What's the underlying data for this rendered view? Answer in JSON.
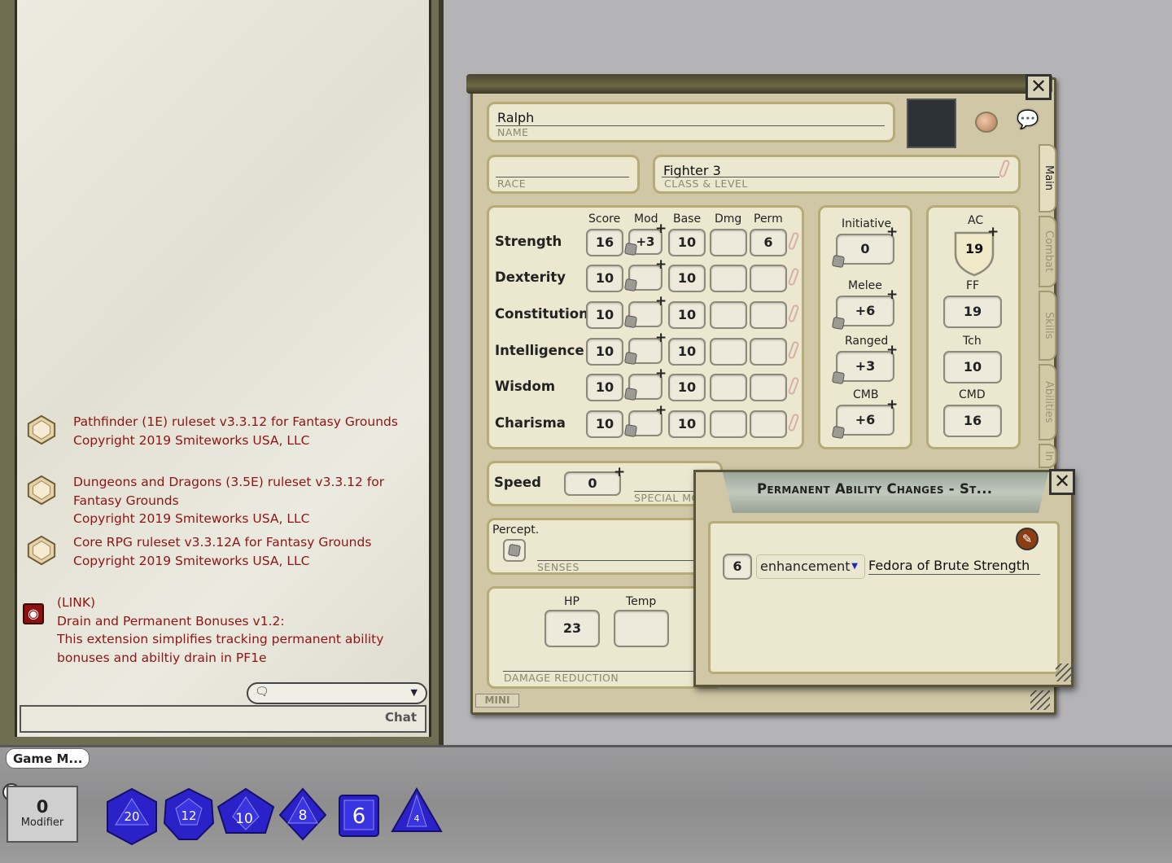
{
  "chat": {
    "messages": [
      {
        "text": "Pathfinder (1E) ruleset v3.3.12 for Fantasy Grounds\nCopyright 2019 Smiteworks USA, LLC",
        "icon": "ruleset-gem-icon"
      },
      {
        "text": "Dungeons and Dragons (3.5E) ruleset v3.3.12 for\nFantasy Grounds\nCopyright 2019 Smiteworks USA, LLC",
        "icon": "ruleset-gem-icon"
      },
      {
        "text": "Core RPG ruleset v3.3.12A for Fantasy Grounds\nCopyright 2019 Smiteworks USA, LLC",
        "icon": "ruleset-gem-icon"
      },
      {
        "text": "(LINK)\nDrain and Permanent Bonuses v1.2:\nThis extension simplifies tracking permanent ability\nbonuses and abiltiy drain in PF1e",
        "icon": "extension-link-icon"
      }
    ],
    "chat_label": "Chat",
    "text_color": "#8f1414"
  },
  "bottom": {
    "gm_tab": "Game M...",
    "modifier_value": "0",
    "modifier_label": "Modifier",
    "dice": [
      "20",
      "12",
      "10",
      "8",
      "6",
      "4"
    ],
    "dice_color": "#2a22c8"
  },
  "sheet": {
    "name_value": "Ralph",
    "name_label": "NAME",
    "race_label": "RACE",
    "class_value": "Fighter 3",
    "class_label": "CLASS & LEVEL",
    "col_headers": {
      "score": "Score",
      "mod": "Mod",
      "base": "Base",
      "dmg": "Dmg",
      "perm": "Perm"
    },
    "abilities": [
      {
        "name": "Strength",
        "score": "16",
        "mod": "+3",
        "base": "10",
        "dmg": "",
        "perm": "6"
      },
      {
        "name": "Dexterity",
        "score": "10",
        "mod": "",
        "base": "10",
        "dmg": "",
        "perm": ""
      },
      {
        "name": "Constitution",
        "score": "10",
        "mod": "",
        "base": "10",
        "dmg": "",
        "perm": ""
      },
      {
        "name": "Intelligence",
        "score": "10",
        "mod": "",
        "base": "10",
        "dmg": "",
        "perm": ""
      },
      {
        "name": "Wisdom",
        "score": "10",
        "mod": "",
        "base": "10",
        "dmg": "",
        "perm": ""
      },
      {
        "name": "Charisma",
        "score": "10",
        "mod": "",
        "base": "10",
        "dmg": "",
        "perm": ""
      }
    ],
    "combat": {
      "initiative_label": "Initiative",
      "initiative": "0",
      "melee_label": "Melee",
      "melee": "+6",
      "ranged_label": "Ranged",
      "ranged": "+3",
      "cmb_label": "CMB",
      "cmb": "+6"
    },
    "defense": {
      "ac_label": "AC",
      "ac": "19",
      "ff_label": "FF",
      "ff": "19",
      "tch_label": "Tch",
      "tch": "10",
      "cmd_label": "CMD",
      "cmd": "16"
    },
    "speed_label": "Speed",
    "speed": "0",
    "special_label": "SPECIAL MO",
    "percept_label": "Percept.",
    "senses_label": "SENSES",
    "hp_label": "HP",
    "hp": "23",
    "temp_label": "Temp",
    "temp": "",
    "dr_label": "DAMAGE REDUCTION",
    "mini_label": "MINI",
    "tabs": [
      "Main",
      "Combat",
      "Skills",
      "Abilities",
      "In"
    ]
  },
  "perm_popup": {
    "title": "Permanent Ability Changes - St...",
    "entry_value": "6",
    "entry_type": "enhancement",
    "entry_name": "Fedora of Brute Strength"
  }
}
